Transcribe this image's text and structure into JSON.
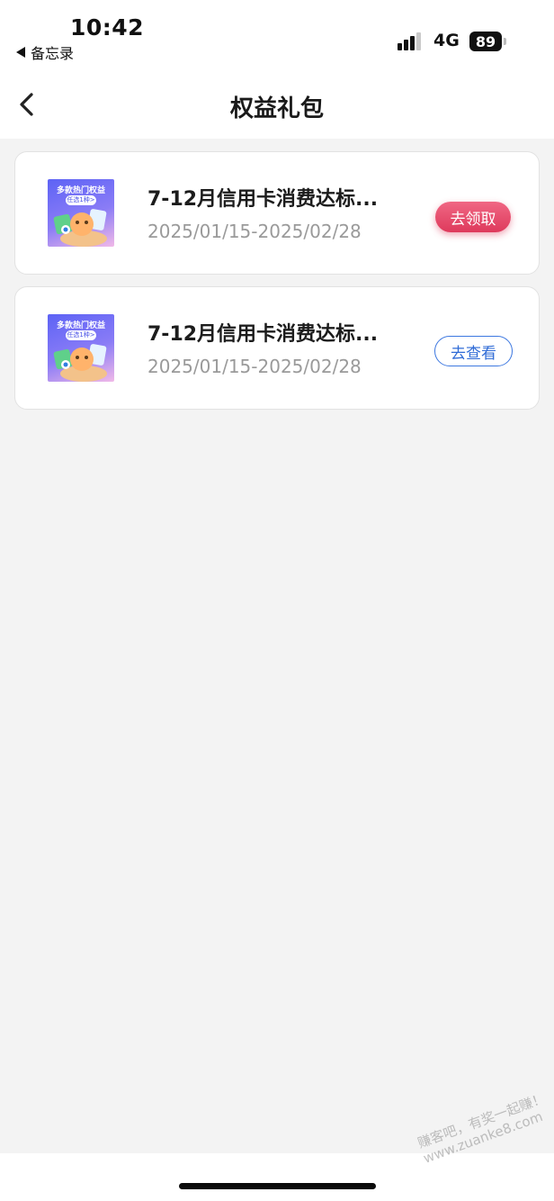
{
  "status_bar": {
    "time": "10:42",
    "back_app": "备忘录",
    "network": "4G",
    "battery": "89"
  },
  "navbar": {
    "title": "权益礼包"
  },
  "items": [
    {
      "thumb_title": "多款热门权益",
      "thumb_tag": "任选1种>",
      "title": "7-12月信用卡消费达标...",
      "date": "2025/01/15-2025/02/28",
      "action": "去领取",
      "action_color": "#de3a5c"
    },
    {
      "thumb_title": "多款热门权益",
      "thumb_tag": "任选1种>",
      "title": "7-12月信用卡消费达标...",
      "date": "2025/01/15-2025/02/28",
      "action": "去查看",
      "action_color": "#2f6bd6"
    }
  ],
  "watermark": {
    "line1": "赚客吧，有奖一起赚！",
    "line2": "www.zuanke8.com"
  }
}
